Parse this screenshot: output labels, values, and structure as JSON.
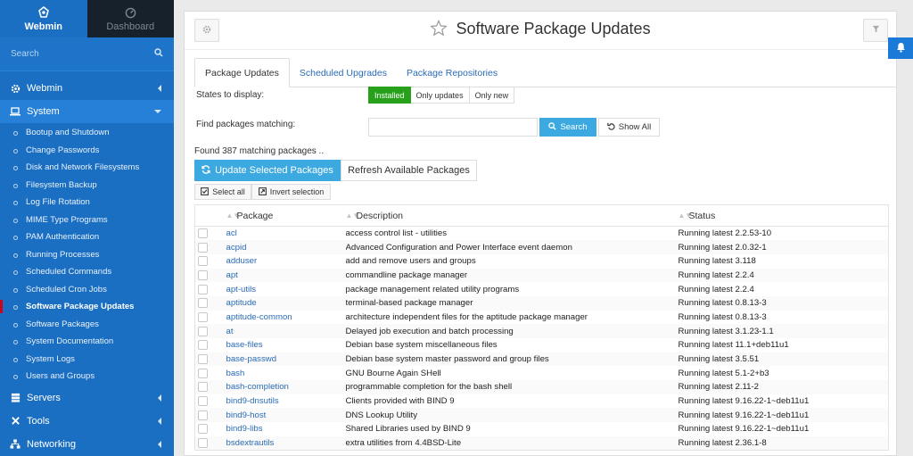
{
  "sidebar": {
    "tabs": [
      {
        "label": "Webmin",
        "icon": "webmin-logo-icon"
      },
      {
        "label": "Dashboard",
        "icon": "dashboard-icon"
      }
    ],
    "search_placeholder": "Search",
    "categories": {
      "webmin": "Webmin",
      "system": "System",
      "servers": "Servers",
      "tools": "Tools",
      "networking": "Networking"
    },
    "system_items": [
      "Bootup and Shutdown",
      "Change Passwords",
      "Disk and Network Filesystems",
      "Filesystem Backup",
      "Log File Rotation",
      "MIME Type Programs",
      "PAM Authentication",
      "Running Processes",
      "Scheduled Commands",
      "Scheduled Cron Jobs",
      "Software Package Updates",
      "Software Packages",
      "System Documentation",
      "System Logs",
      "Users and Groups"
    ],
    "active_item": "Software Package Updates",
    "colors": {
      "background": "#1b6fc2",
      "active_marker": "#d0021b"
    }
  },
  "header": {
    "title": "Software Package Updates"
  },
  "tabs": [
    "Package Updates",
    "Scheduled Upgrades",
    "Package Repositories"
  ],
  "filters": {
    "states_label": "States to display:",
    "states": [
      "Installed",
      "Only updates",
      "Only new"
    ],
    "selected_state": "Installed",
    "find_label": "Find packages matching:",
    "find_value": "",
    "search_button": "Search",
    "show_all_button": "Show All"
  },
  "results": {
    "found_text": "Found 387 matching packages ..",
    "update_button": "Update Selected Packages",
    "refresh_button": "Refresh Available Packages",
    "select_all": "Select all",
    "invert_selection": "Invert selection"
  },
  "table": {
    "columns": [
      "Package",
      "Description",
      "Status"
    ],
    "rows": [
      {
        "package": "acl",
        "description": "access control list - utilities",
        "status": "Running latest 2.2.53-10"
      },
      {
        "package": "acpid",
        "description": "Advanced Configuration and Power Interface event daemon",
        "status": "Running latest 2.0.32-1"
      },
      {
        "package": "adduser",
        "description": "add and remove users and groups",
        "status": "Running latest 3.118"
      },
      {
        "package": "apt",
        "description": "commandline package manager",
        "status": "Running latest 2.2.4"
      },
      {
        "package": "apt-utils",
        "description": "package management related utility programs",
        "status": "Running latest 2.2.4"
      },
      {
        "package": "aptitude",
        "description": "terminal-based package manager",
        "status": "Running latest 0.8.13-3"
      },
      {
        "package": "aptitude-common",
        "description": "architecture independent files for the aptitude package manager",
        "status": "Running latest 0.8.13-3"
      },
      {
        "package": "at",
        "description": "Delayed job execution and batch processing",
        "status": "Running latest 3.1.23-1.1"
      },
      {
        "package": "base-files",
        "description": "Debian base system miscellaneous files",
        "status": "Running latest 11.1+deb11u1"
      },
      {
        "package": "base-passwd",
        "description": "Debian base system master password and group files",
        "status": "Running latest 3.5.51"
      },
      {
        "package": "bash",
        "description": "GNU Bourne Again SHell",
        "status": "Running latest 5.1-2+b3"
      },
      {
        "package": "bash-completion",
        "description": "programmable completion for the bash shell",
        "status": "Running latest 2.11-2"
      },
      {
        "package": "bind9-dnsutils",
        "description": "Clients provided with BIND 9",
        "status": "Running latest 9.16.22-1~deb11u1"
      },
      {
        "package": "bind9-host",
        "description": "DNS Lookup Utility",
        "status": "Running latest 9.16.22-1~deb11u1"
      },
      {
        "package": "bind9-libs",
        "description": "Shared Libraries used by BIND 9",
        "status": "Running latest 9.16.22-1~deb11u1"
      },
      {
        "package": "bsdextrautils",
        "description": "extra utilities from 4.4BSD-Lite",
        "status": "Running latest 2.36.1-8"
      }
    ]
  },
  "colors": {
    "primary_button": "#3ca9e0",
    "selected_state": "#27a11c",
    "link": "#2a6bb5"
  }
}
